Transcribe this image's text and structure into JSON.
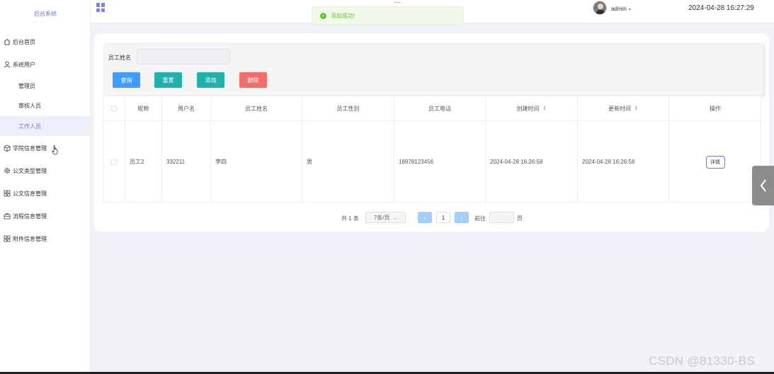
{
  "sidebar": {
    "logo": "后台系统",
    "menu": [
      {
        "label": "后台首页",
        "icon": "home-icon"
      },
      {
        "label": "系统用户",
        "icon": "user-icon"
      },
      {
        "label": "学院信息管理",
        "icon": "cube-icon"
      },
      {
        "label": "公文类型管理",
        "icon": "gear-icon"
      },
      {
        "label": "公文信息管理",
        "icon": "grid-icon"
      },
      {
        "label": "流程信息管理",
        "icon": "briefcase-icon"
      },
      {
        "label": "附件信息管理",
        "icon": "grid-icon"
      }
    ],
    "submenu": [
      {
        "label": "管理员"
      },
      {
        "label": "审核人员"
      },
      {
        "label": "工作人员",
        "active": true
      }
    ]
  },
  "header": {
    "title": "…",
    "user": "admin",
    "datetime": "2024-04-28 16:27:29"
  },
  "toast": {
    "message": "添加成功!"
  },
  "search": {
    "label": "员工姓名",
    "value": "",
    "placeholder": ""
  },
  "buttons": {
    "query": "查询",
    "reset": "重置",
    "add": "添加",
    "delete": "删除"
  },
  "table": {
    "headers": [
      "",
      "昵称",
      "用户名",
      "员工姓名",
      "员工性别",
      "员工电话",
      "创建时间",
      "更新时间",
      "操作"
    ],
    "rows": [
      {
        "nickname": "员工2",
        "username": "332211",
        "name": "李四",
        "gender": "男",
        "phone": "18978123456",
        "created": "2024-04-28 16:26:58",
        "updated": "2024-04-28 16:26:58",
        "action": "详情"
      }
    ]
  },
  "pagination": {
    "total": "共 1 条",
    "page_size": "7条/页",
    "current_page": "1",
    "goto": "前往",
    "goto_value": "",
    "unit": "页"
  },
  "watermark": "CSDN @81330-BS",
  "colors": {
    "primary": "#409eff",
    "teal": "#20b2aa",
    "danger": "#f56c6c",
    "accent": "#6b72d8",
    "success": "#67c23a"
  }
}
